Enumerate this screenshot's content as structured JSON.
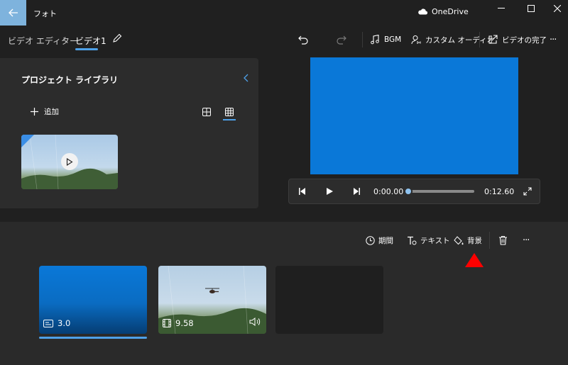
{
  "app": {
    "title": "フォト",
    "onedrive_label": "OneDrive"
  },
  "breadcrumb": {
    "root": "ビデオ エディター",
    "separator": "›",
    "current": "ビデオ1"
  },
  "toolbar": {
    "bgm_label": "BGM",
    "custom_audio_label": "カスタム オーディオ",
    "finish_video_label": "ビデオの完了",
    "more_label": "···"
  },
  "library": {
    "title": "プロジェクト ライブラリ",
    "add_label": "追加"
  },
  "player": {
    "current_time": "0:00.00",
    "total_time": "0:12.60",
    "progress": 0
  },
  "storyboard_toolbar": {
    "duration_label": "期間",
    "text_label": "テキスト",
    "background_label": "背景",
    "more_label": "···"
  },
  "clips": [
    {
      "type": "title-card",
      "duration": "3.0",
      "icon": "text-card-icon"
    },
    {
      "type": "video",
      "duration": "9.58",
      "icon": "film-icon"
    }
  ],
  "colors": {
    "accent": "#4ea1e8",
    "preview_blue": "#0a78d8",
    "marker_red": "#ff0000"
  }
}
